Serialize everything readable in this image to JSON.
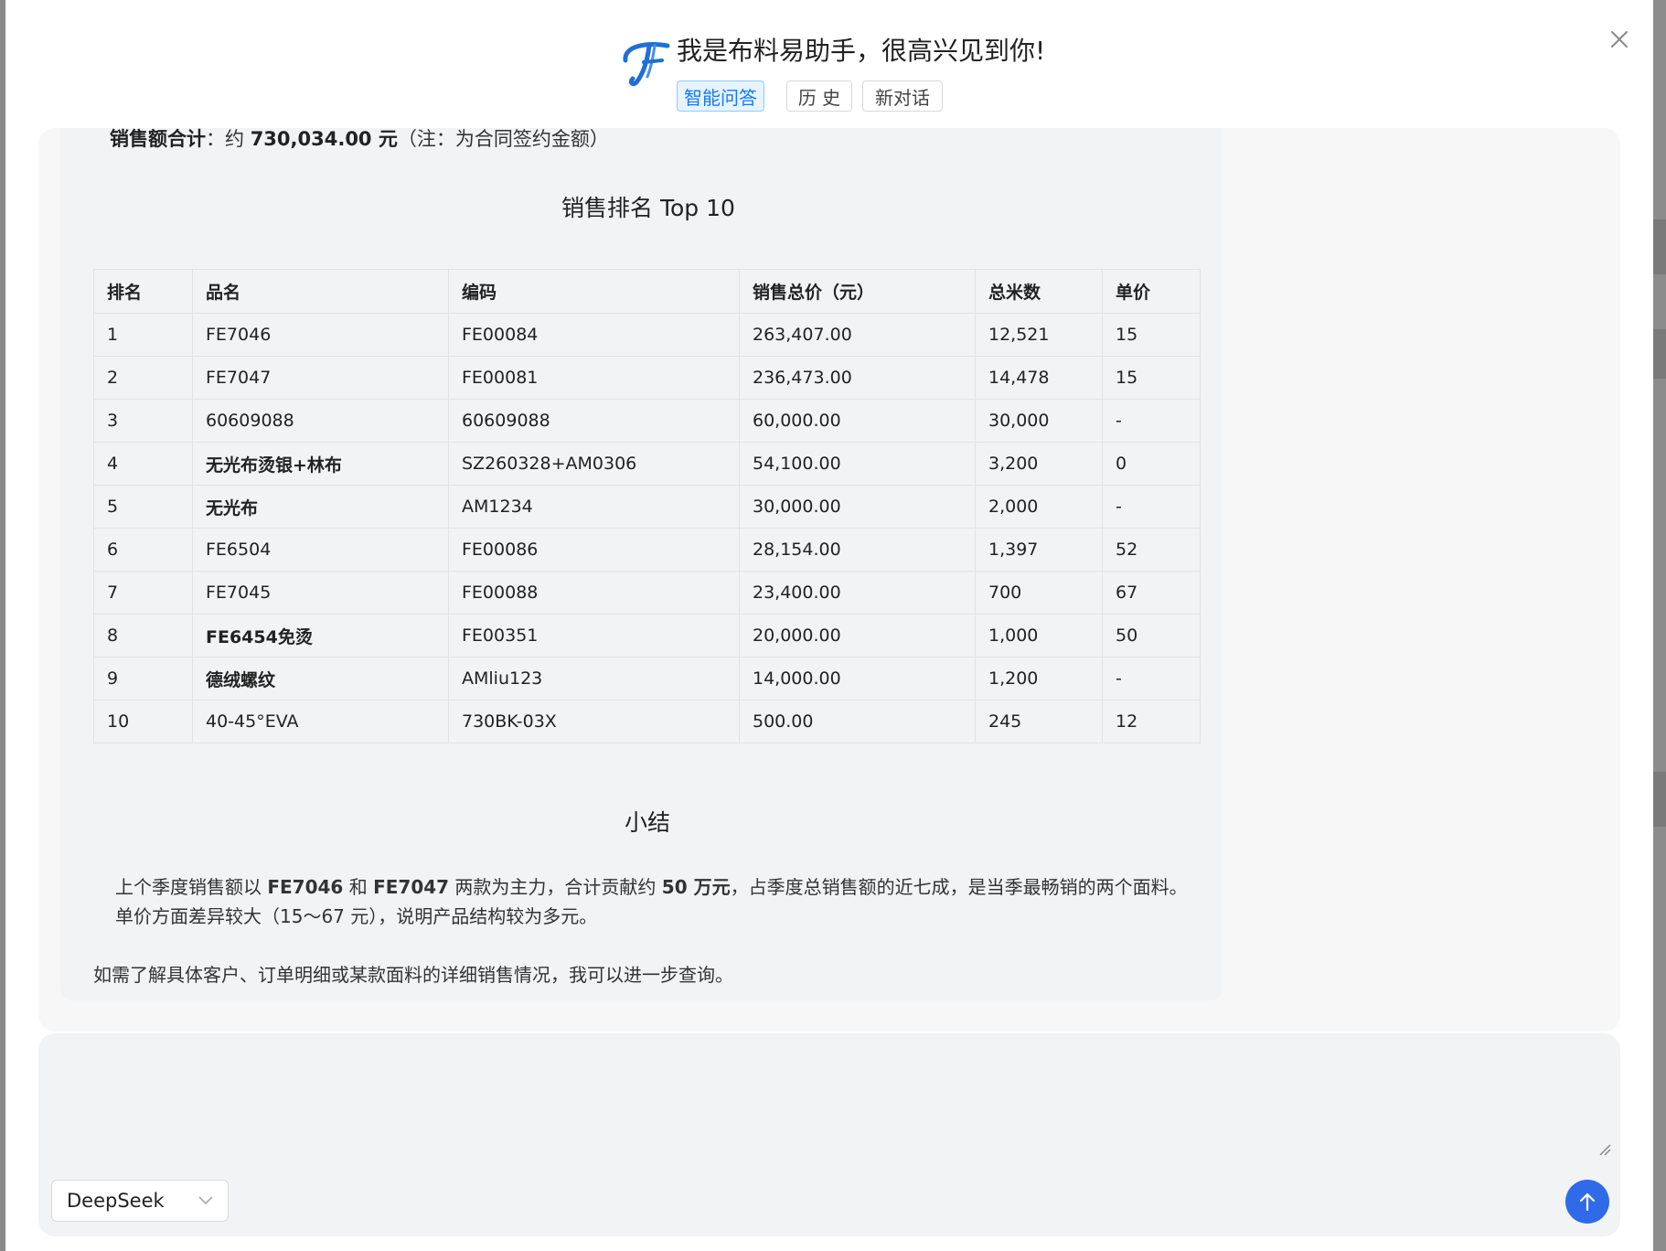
{
  "header": {
    "greeting": "我是布料易助手，很高兴见到你!",
    "tabs": [
      {
        "label": "智能问答",
        "active": true
      },
      {
        "label": "历 史",
        "active": false
      },
      {
        "label": "新对话",
        "active": false
      }
    ],
    "logo_icon": "logo-icon",
    "close_icon": "close-icon",
    "accent_color": "#1677ff"
  },
  "message": {
    "sum_label": "销售额合计",
    "sum_colon": "：约 ",
    "sum_value": "730,034.00 元",
    "sum_note": "（注：为合同签约金额）",
    "ranking_title": "销售排名 Top 10",
    "table": {
      "headers": [
        "排名",
        "品名",
        "编码",
        "销售总价（元）",
        "总米数",
        "单价"
      ],
      "rows": [
        [
          "1",
          "FE7046",
          "FE00084",
          "263,407.00",
          "12,521",
          "15"
        ],
        [
          "2",
          "FE7047",
          "FE00081",
          "236,473.00",
          "14,478",
          "15"
        ],
        [
          "3",
          "60609088",
          "60609088",
          "60,000.00",
          "30,000",
          "-"
        ],
        [
          "4",
          "无光布烫银+林布",
          "SZ260328+AM0306",
          "54,100.00",
          "3,200",
          "0"
        ],
        [
          "5",
          "无光布",
          "AM1234",
          "30,000.00",
          "2,000",
          "-"
        ],
        [
          "6",
          "FE6504",
          "FE00086",
          "28,154.00",
          "1,397",
          "52"
        ],
        [
          "7",
          "FE7045",
          "FE00088",
          "23,400.00",
          "700",
          "67"
        ],
        [
          "8",
          "FE6454免烫",
          "FE00351",
          "20,000.00",
          "1,000",
          "50"
        ],
        [
          "9",
          "德绒螺纹",
          "AMliu123",
          "14,000.00",
          "1,200",
          "-"
        ],
        [
          "10",
          "40-45°EVA",
          "730BK-03X",
          "500.00",
          "245",
          "12"
        ]
      ]
    },
    "summary_title": "小结",
    "summary": {
      "p1": "上个季度销售额以 ",
      "b1": "FE7046",
      "p2": " 和 ",
      "b2": "FE7047",
      "p3": " 两款为主力，合计贡献约 ",
      "b3": "50 万元",
      "p4": "，占季度总销售额的近七成，是当季最畅销的两个面料。单价方面差异较大（15～67 元），说明产品结构较为多元。"
    },
    "followup": "如需了解具体客户、订单明细或某款面料的详细销售情况，我可以进一步查询。"
  },
  "input": {
    "placeholder": "",
    "model_selected": "DeepSeek",
    "send_icon": "arrow-up-icon",
    "send_color": "#2f6ae8"
  }
}
